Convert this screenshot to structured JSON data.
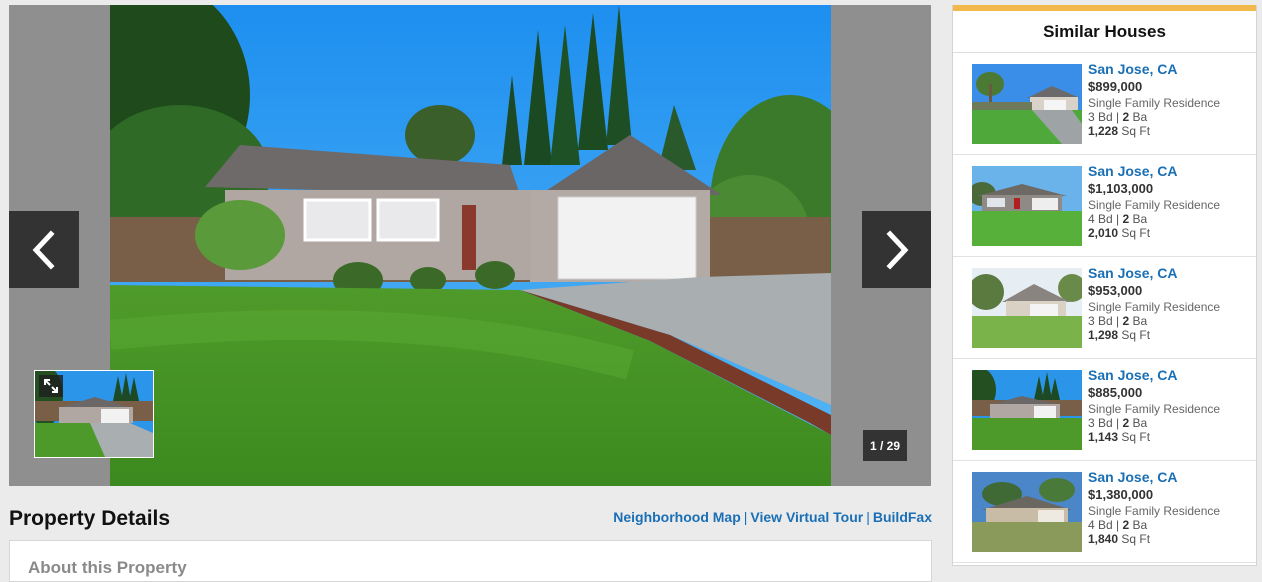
{
  "gallery": {
    "counter": "1 / 29",
    "prev_icon": "chevron-left-icon",
    "next_icon": "chevron-right-icon",
    "expand_icon": "expand-icon"
  },
  "details": {
    "title": "Property Details",
    "links": [
      "Neighborhood Map",
      "View Virtual Tour",
      "BuildFax"
    ],
    "about_title": "About this Property"
  },
  "similar": {
    "title": "Similar Houses",
    "accent": "#f2b84b",
    "link_color": "#1a6fb5",
    "listings": [
      {
        "city": "San Jose, CA",
        "price": "$899,000",
        "type": "Single Family Residence",
        "beds": "3",
        "beds_label": " Bd | ",
        "baths": "2",
        "baths_label": " Ba",
        "sqft": "1,228",
        "sqft_label": " Sq Ft"
      },
      {
        "city": "San Jose, CA",
        "price": "$1,103,000",
        "type": "Single Family Residence",
        "beds": "4",
        "beds_label": " Bd | ",
        "baths": "2",
        "baths_label": " Ba",
        "sqft": "2,010",
        "sqft_label": " Sq Ft"
      },
      {
        "city": "San Jose, CA",
        "price": "$953,000",
        "type": "Single Family Residence",
        "beds": "3",
        "beds_label": " Bd | ",
        "baths": "2",
        "baths_label": " Ba",
        "sqft": "1,298",
        "sqft_label": " Sq Ft"
      },
      {
        "city": "San Jose, CA",
        "price": "$885,000",
        "type": "Single Family Residence",
        "beds": "3",
        "beds_label": " Bd | ",
        "baths": "2",
        "baths_label": " Ba",
        "sqft": "1,143",
        "sqft_label": " Sq Ft"
      },
      {
        "city": "San Jose, CA",
        "price": "$1,380,000",
        "type": "Single Family Residence",
        "beds": "4",
        "beds_label": " Bd | ",
        "baths": "2",
        "baths_label": " Ba",
        "sqft": "1,840",
        "sqft_label": " Sq Ft"
      }
    ]
  }
}
